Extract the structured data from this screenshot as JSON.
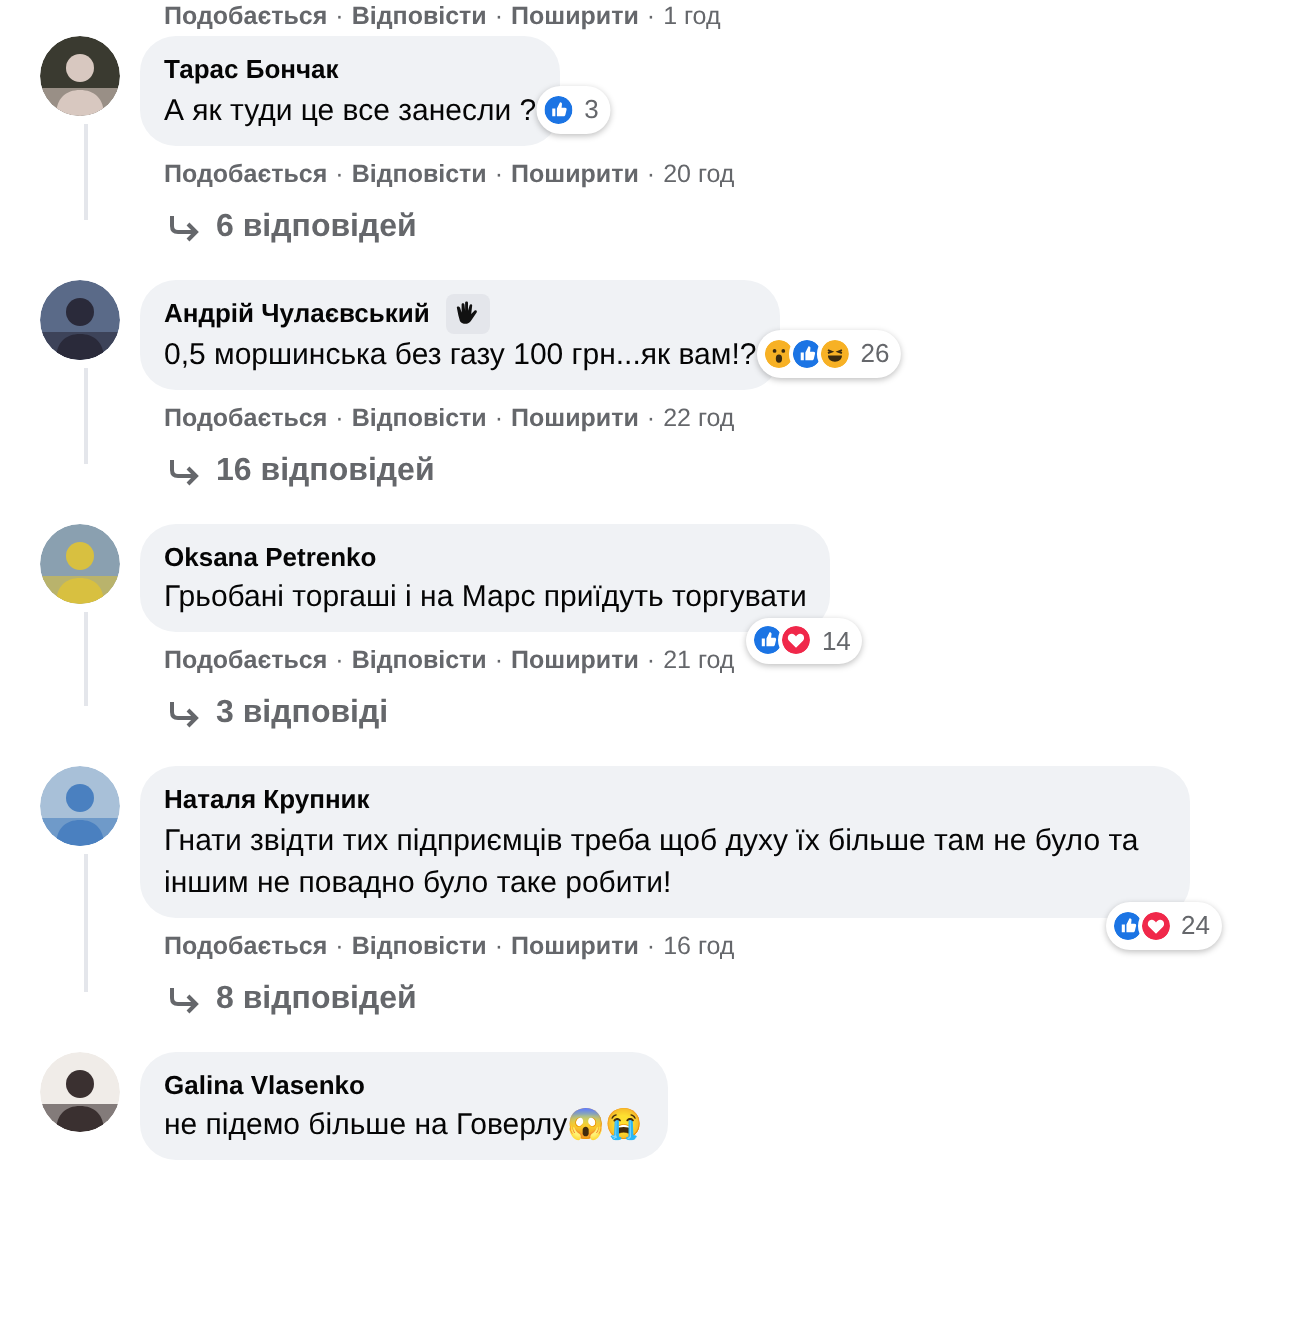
{
  "top_actions": {
    "like": "Подобається",
    "reply": "Відповісти",
    "share": "Поширити",
    "time": "1 год",
    "separator": "·"
  },
  "comments": [
    {
      "author": "Тарас Бончак",
      "badge": false,
      "text": "А як туди це все занесли ?",
      "reactions": [
        {
          "kind": "like"
        }
      ],
      "reaction_count": "3",
      "actions": {
        "like": "Подобається",
        "reply": "Відповісти",
        "share": "Поширити",
        "time": "20 год",
        "separator": "·"
      },
      "replies": "6 відповідей"
    },
    {
      "author": "Андрій Чулаєвський",
      "badge": true,
      "text": "0,5 моршинська без газу 100 грн...як вам!?",
      "reactions": [
        {
          "kind": "wow"
        },
        {
          "kind": "like"
        },
        {
          "kind": "haha"
        }
      ],
      "reaction_count": "26",
      "actions": {
        "like": "Подобається",
        "reply": "Відповісти",
        "share": "Поширити",
        "time": "22 год",
        "separator": "·"
      },
      "replies": "16 відповідей"
    },
    {
      "author": "Oksana Petrenko",
      "badge": false,
      "text": "Грьобані торгаші і на Марс приїдуть торгувати",
      "reactions": [
        {
          "kind": "like"
        },
        {
          "kind": "love"
        }
      ],
      "reaction_count": "14",
      "actions": {
        "like": "Подобається",
        "reply": "Відповісти",
        "share": "Поширити",
        "time": "21 год",
        "separator": "·"
      },
      "replies": "3 відповіді"
    },
    {
      "author": "Наталя Крупник",
      "badge": false,
      "text": "Гнати звідти тих підприємців треба щоб духу їх більше там не було та іншим не повадно було таке робити!",
      "reactions": [
        {
          "kind": "like"
        },
        {
          "kind": "love"
        }
      ],
      "reaction_count": "24",
      "actions": {
        "like": "Подобається",
        "reply": "Відповісти",
        "share": "Поширити",
        "time": "16 год",
        "separator": "·"
      },
      "replies": "8 відповідей"
    },
    {
      "author": "Galina Vlasenko",
      "badge": false,
      "text": "не підемо більше на Говерлу😱😭"
    }
  ]
}
